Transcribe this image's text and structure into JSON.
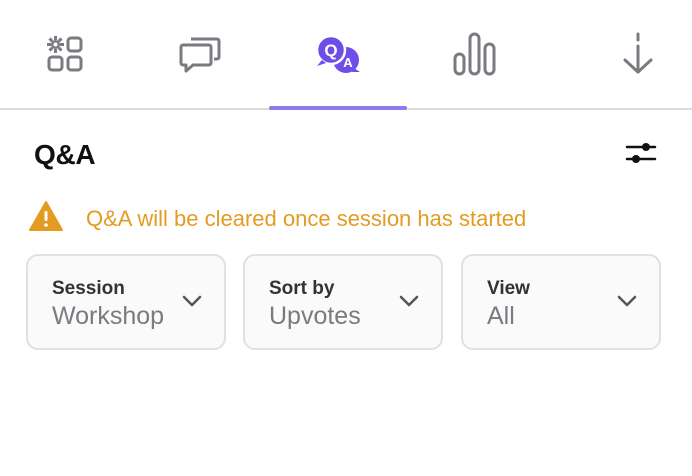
{
  "tabs": [
    {
      "name": "apps",
      "icon": "apps-icon",
      "active": false
    },
    {
      "name": "chat",
      "icon": "chat-icon",
      "active": false
    },
    {
      "name": "qa",
      "icon": "qa-icon",
      "icon_text": "Q A",
      "active": true
    },
    {
      "name": "polls",
      "icon": "bar-chart-icon",
      "active": false
    },
    {
      "name": "download",
      "icon": "download-icon",
      "active": false
    }
  ],
  "colors": {
    "accent": "#8b7cf0",
    "qa_icon": "#6d4ee8",
    "warning": "#e39b22",
    "icon_gray": "#7a7a80"
  },
  "panel": {
    "title": "Q&A",
    "filter_icon": "sliders-icon"
  },
  "warning": {
    "icon": "warning-triangle-icon",
    "text": "Q&A will be cleared once session has started"
  },
  "dropdowns": {
    "session": {
      "label": "Session",
      "value": "Workshop"
    },
    "sort": {
      "label": "Sort by",
      "value": "Upvotes"
    },
    "view": {
      "label": "View",
      "value": "All"
    }
  }
}
